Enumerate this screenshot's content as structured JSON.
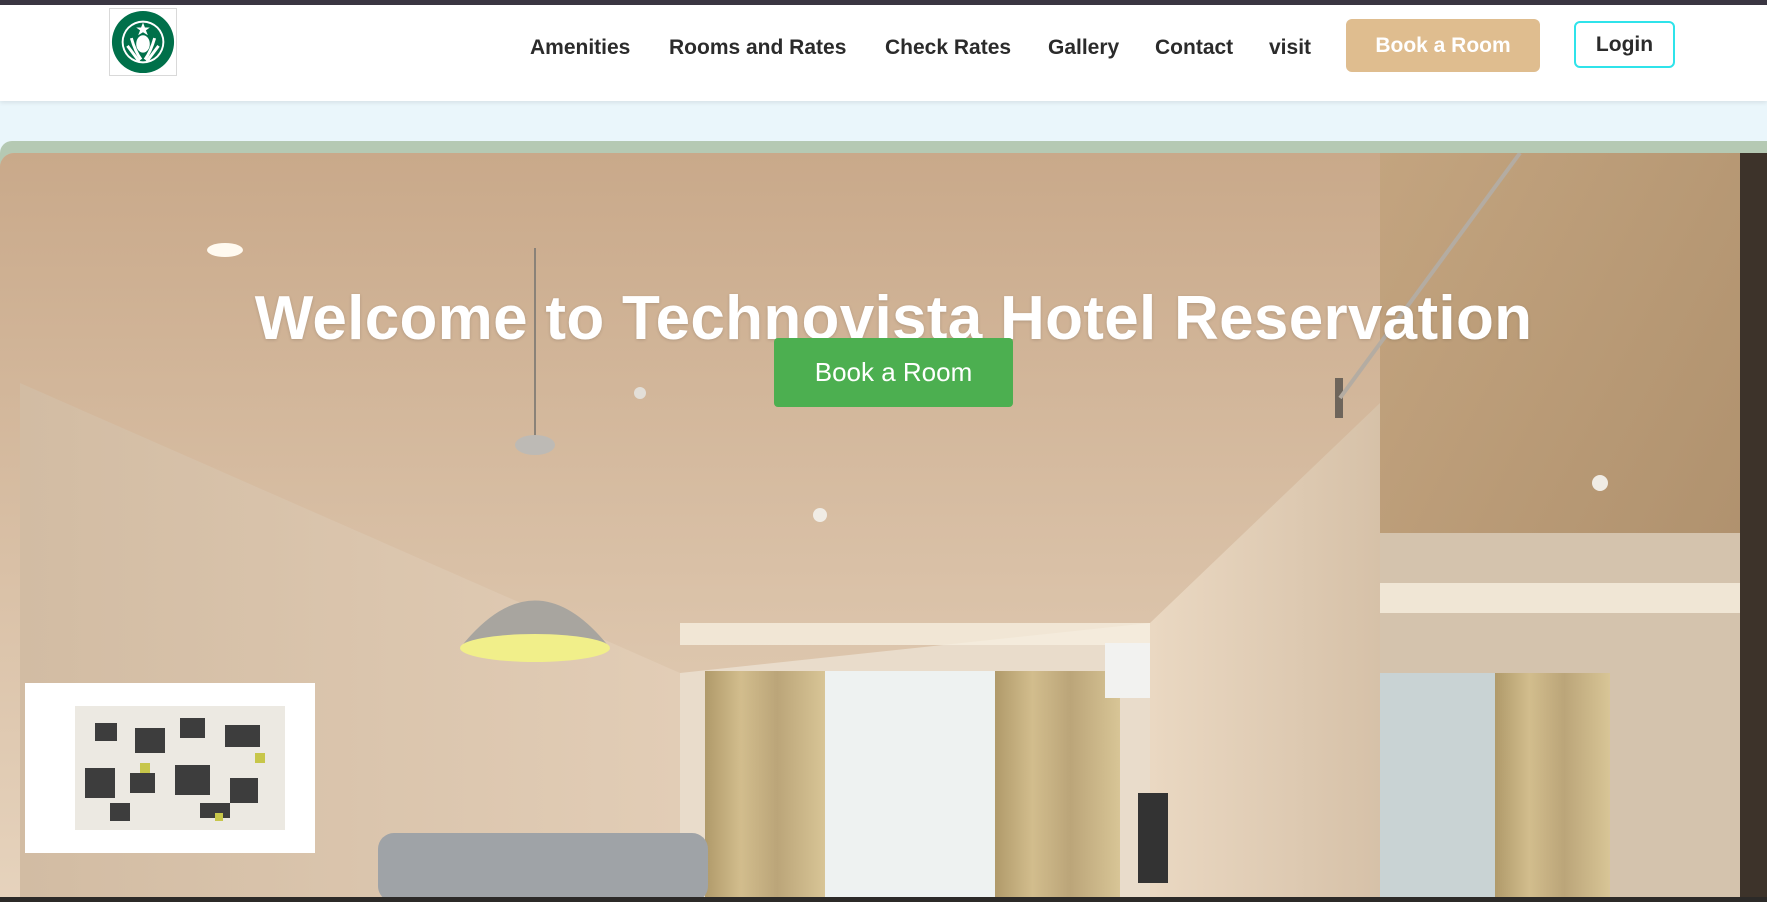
{
  "nav": {
    "logo_icon": "siren-logo-icon",
    "links": [
      "Amenities",
      "Rooms and Rates",
      "Check Rates",
      "Gallery",
      "Contact",
      "visit"
    ],
    "book_button": "Book a Room",
    "login_button": "Login"
  },
  "hero": {
    "title": "Welcome to Technovista Hotel Reservation",
    "book_button": "Book a Room",
    "background": "hotel-room-photo"
  },
  "colors": {
    "nav_book_bg": "#dfbd8f",
    "hero_button_bg": "#4caf50",
    "login_border": "#2fe3ea",
    "page_bg": "#eaf6fb"
  }
}
